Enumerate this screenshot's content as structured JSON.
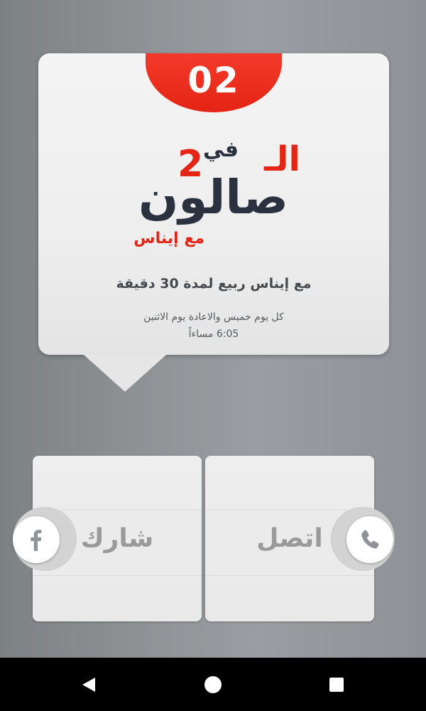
{
  "card": {
    "episode_number": "02",
    "logo": {
      "prefix_text": "الـ",
      "number_text": "2",
      "fi_text": "في",
      "main_text": "صالون",
      "host_text": "مع إيناس"
    },
    "title": "مع إيناس ربيع لمدة 30 دقيقة",
    "schedule_days": "كل يوم خميس والاعادة يوم الاثنين",
    "schedule_time": "6:05 مساءاً"
  },
  "actions": {
    "share_label": "شارك",
    "call_label": "اتصل"
  },
  "icons": {
    "share": "facebook-icon",
    "call": "phone-icon",
    "nav_back": "back-triangle-icon",
    "nav_home": "home-circle-icon",
    "nav_recent": "recents-square-icon"
  },
  "colors": {
    "badge_red": "#e42414",
    "logo_dark": "#2a3240",
    "text_dark": "#444a50",
    "button_label": "#9a9a9a"
  }
}
